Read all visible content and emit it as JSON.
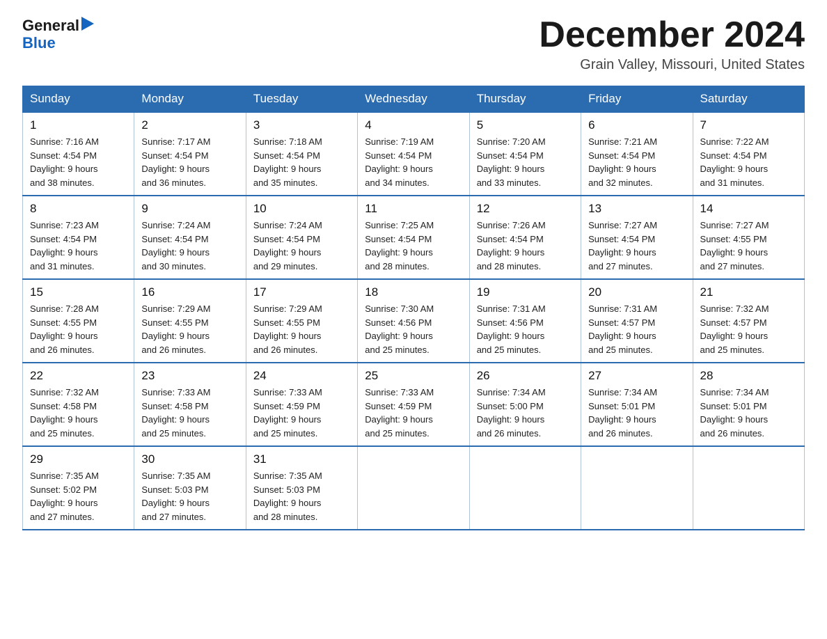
{
  "logo": {
    "line1": "General",
    "arrow": "▶",
    "line2": "Blue"
  },
  "title": "December 2024",
  "location": "Grain Valley, Missouri, United States",
  "weekdays": [
    "Sunday",
    "Monday",
    "Tuesday",
    "Wednesday",
    "Thursday",
    "Friday",
    "Saturday"
  ],
  "weeks": [
    [
      {
        "day": "1",
        "sunrise": "7:16 AM",
        "sunset": "4:54 PM",
        "daylight": "9 hours and 38 minutes."
      },
      {
        "day": "2",
        "sunrise": "7:17 AM",
        "sunset": "4:54 PM",
        "daylight": "9 hours and 36 minutes."
      },
      {
        "day": "3",
        "sunrise": "7:18 AM",
        "sunset": "4:54 PM",
        "daylight": "9 hours and 35 minutes."
      },
      {
        "day": "4",
        "sunrise": "7:19 AM",
        "sunset": "4:54 PM",
        "daylight": "9 hours and 34 minutes."
      },
      {
        "day": "5",
        "sunrise": "7:20 AM",
        "sunset": "4:54 PM",
        "daylight": "9 hours and 33 minutes."
      },
      {
        "day": "6",
        "sunrise": "7:21 AM",
        "sunset": "4:54 PM",
        "daylight": "9 hours and 32 minutes."
      },
      {
        "day": "7",
        "sunrise": "7:22 AM",
        "sunset": "4:54 PM",
        "daylight": "9 hours and 31 minutes."
      }
    ],
    [
      {
        "day": "8",
        "sunrise": "7:23 AM",
        "sunset": "4:54 PM",
        "daylight": "9 hours and 31 minutes."
      },
      {
        "day": "9",
        "sunrise": "7:24 AM",
        "sunset": "4:54 PM",
        "daylight": "9 hours and 30 minutes."
      },
      {
        "day": "10",
        "sunrise": "7:24 AM",
        "sunset": "4:54 PM",
        "daylight": "9 hours and 29 minutes."
      },
      {
        "day": "11",
        "sunrise": "7:25 AM",
        "sunset": "4:54 PM",
        "daylight": "9 hours and 28 minutes."
      },
      {
        "day": "12",
        "sunrise": "7:26 AM",
        "sunset": "4:54 PM",
        "daylight": "9 hours and 28 minutes."
      },
      {
        "day": "13",
        "sunrise": "7:27 AM",
        "sunset": "4:54 PM",
        "daylight": "9 hours and 27 minutes."
      },
      {
        "day": "14",
        "sunrise": "7:27 AM",
        "sunset": "4:55 PM",
        "daylight": "9 hours and 27 minutes."
      }
    ],
    [
      {
        "day": "15",
        "sunrise": "7:28 AM",
        "sunset": "4:55 PM",
        "daylight": "9 hours and 26 minutes."
      },
      {
        "day": "16",
        "sunrise": "7:29 AM",
        "sunset": "4:55 PM",
        "daylight": "9 hours and 26 minutes."
      },
      {
        "day": "17",
        "sunrise": "7:29 AM",
        "sunset": "4:55 PM",
        "daylight": "9 hours and 26 minutes."
      },
      {
        "day": "18",
        "sunrise": "7:30 AM",
        "sunset": "4:56 PM",
        "daylight": "9 hours and 25 minutes."
      },
      {
        "day": "19",
        "sunrise": "7:31 AM",
        "sunset": "4:56 PM",
        "daylight": "9 hours and 25 minutes."
      },
      {
        "day": "20",
        "sunrise": "7:31 AM",
        "sunset": "4:57 PM",
        "daylight": "9 hours and 25 minutes."
      },
      {
        "day": "21",
        "sunrise": "7:32 AM",
        "sunset": "4:57 PM",
        "daylight": "9 hours and 25 minutes."
      }
    ],
    [
      {
        "day": "22",
        "sunrise": "7:32 AM",
        "sunset": "4:58 PM",
        "daylight": "9 hours and 25 minutes."
      },
      {
        "day": "23",
        "sunrise": "7:33 AM",
        "sunset": "4:58 PM",
        "daylight": "9 hours and 25 minutes."
      },
      {
        "day": "24",
        "sunrise": "7:33 AM",
        "sunset": "4:59 PM",
        "daylight": "9 hours and 25 minutes."
      },
      {
        "day": "25",
        "sunrise": "7:33 AM",
        "sunset": "4:59 PM",
        "daylight": "9 hours and 25 minutes."
      },
      {
        "day": "26",
        "sunrise": "7:34 AM",
        "sunset": "5:00 PM",
        "daylight": "9 hours and 26 minutes."
      },
      {
        "day": "27",
        "sunrise": "7:34 AM",
        "sunset": "5:01 PM",
        "daylight": "9 hours and 26 minutes."
      },
      {
        "day": "28",
        "sunrise": "7:34 AM",
        "sunset": "5:01 PM",
        "daylight": "9 hours and 26 minutes."
      }
    ],
    [
      {
        "day": "29",
        "sunrise": "7:35 AM",
        "sunset": "5:02 PM",
        "daylight": "9 hours and 27 minutes."
      },
      {
        "day": "30",
        "sunrise": "7:35 AM",
        "sunset": "5:03 PM",
        "daylight": "9 hours and 27 minutes."
      },
      {
        "day": "31",
        "sunrise": "7:35 AM",
        "sunset": "5:03 PM",
        "daylight": "9 hours and 28 minutes."
      },
      null,
      null,
      null,
      null
    ]
  ]
}
